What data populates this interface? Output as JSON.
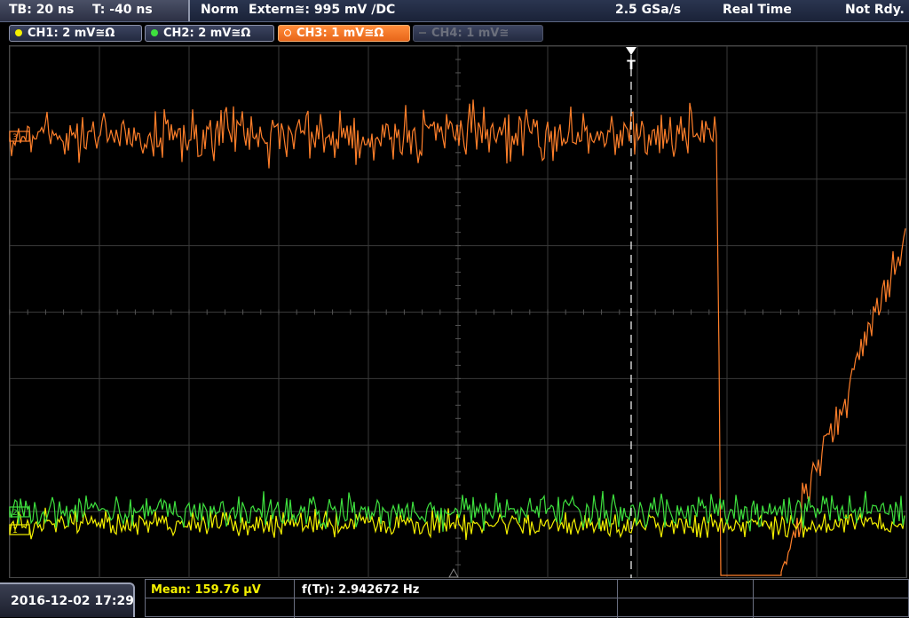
{
  "topbar": {
    "timebase": "TB: 20 ns",
    "trigger_pos": "T: -40 ns",
    "trigger_mode": "Norm",
    "trigger_source": "Extern≅: 995 mV ∕DC",
    "sample_rate": "2.5 GSa/s",
    "acq_mode": "Real Time",
    "status": "Not Rdy."
  },
  "channels": [
    {
      "label": "CH1: 2 mV≅Ω",
      "color": "#f4f000",
      "active": false,
      "enabled": true
    },
    {
      "label": "CH2: 2 mV≅Ω",
      "color": "#3ee03e",
      "active": false,
      "enabled": true
    },
    {
      "label": "CH3: 1 mV≅Ω",
      "color": "#ff7f2a",
      "active": true,
      "enabled": true
    },
    {
      "label": "CH4: 1 mV≅",
      "color": "#6b6f7c",
      "active": false,
      "enabled": false
    }
  ],
  "markers": {
    "trigger_marker": "T",
    "ch3_marker": "3",
    "ch2_marker": "2",
    "ch1_marker": "1"
  },
  "measurements": {
    "mean": "Mean: 159.76 µV",
    "freq": "f(Tr): 2.942672 Hz"
  },
  "datetime": "2016-12-02 17:29",
  "colors": {
    "ch1": "#f4f000",
    "ch2": "#3ee03e",
    "ch3": "#ff7f2a",
    "grid": "#3a3a3a"
  }
}
